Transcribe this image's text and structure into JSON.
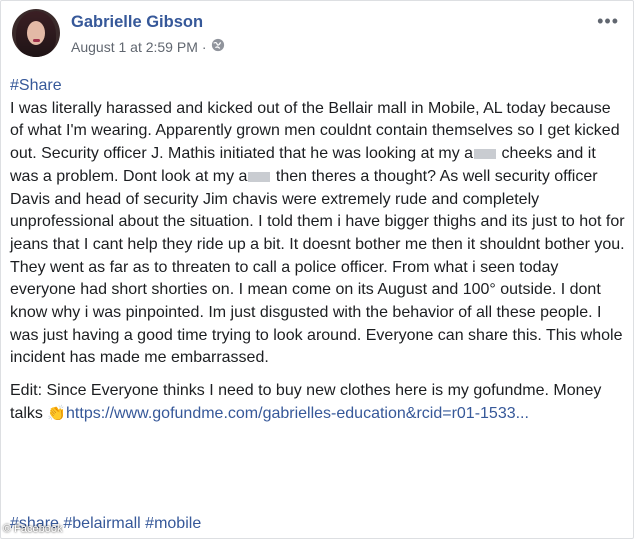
{
  "post": {
    "author": "Gabrielle Gibson",
    "timestamp": "August 1 at 2:59 PM",
    "privacy_icon": "globe-icon",
    "more_icon": "more-options-icon",
    "hashtag_share": "#Share",
    "paragraph1": {
      "seg1": "I was literally harassed and kicked out of the Bellair mall in Mobile, AL today because of what I'm wearing. Apparently grown men couldnt contain themselves so I get kicked out. Security officer J. Mathis initiated that he was looking at my a",
      "seg2": " cheeks and it was a problem. Dont look at my a",
      "seg3": " then theres a thought? As well security officer Davis and head of security Jim chavis were extremely rude and completely unprofessional about the situation. I told them i have bigger thighs and its just to hot for jeans that I cant help they ride up a bit. It doesnt bother me then it shouldnt bother you. They went as far as to threaten to call a police officer. From what i seen today everyone had short shorties on. I mean come on its August and 100° outside. I dont know why i was pinpointed. Im just disgusted with the behavior of all these people. I was just having a good time trying to look around. Everyone can share this. This whole incident has made me embarrassed."
    },
    "paragraph2": {
      "text": "Edit: Since Everyone thinks I need to buy new clothes here is my gofundme. Money talks ",
      "emoji": "👏",
      "link": "https://www.gofundme.com/gabrielles-education&rcid=r01-1533..."
    },
    "hashtags": "#share #belairmall #mobile",
    "watermark": "© Facebook"
  },
  "colors": {
    "link": "#365899",
    "text": "#1c1e21",
    "meta": "#616770"
  }
}
